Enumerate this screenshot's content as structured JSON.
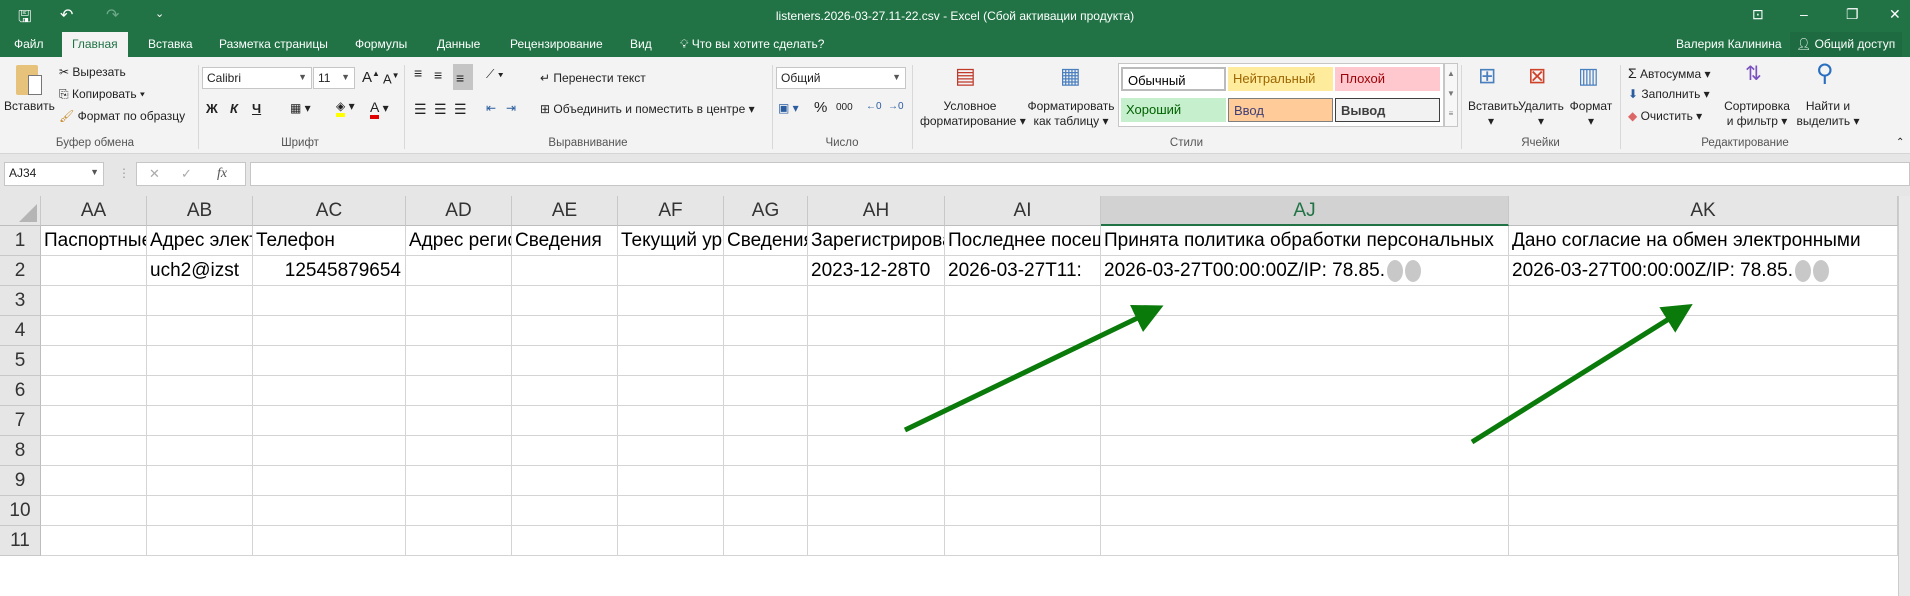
{
  "titlebar": {
    "title": "listeners.2026-03-27.11-22.csv - Excel (Сбой активации продукта)",
    "user": "Валерия Калинина",
    "share": "Общий доступ"
  },
  "tabs": [
    "Файл",
    "Главная",
    "Вставка",
    "Разметка страницы",
    "Формулы",
    "Данные",
    "Рецензирование",
    "Вид"
  ],
  "tell_me": "Что вы хотите сделать?",
  "ribbon": {
    "clipboard": {
      "paste": "Вставить",
      "cut": "Вырезать",
      "copy": "Копировать",
      "format_painter": "Формат по образцу",
      "label": "Буфер обмена"
    },
    "font": {
      "name": "Calibri",
      "size": "11",
      "bold": "Ж",
      "italic": "К",
      "underline": "Ч",
      "label": "Шрифт"
    },
    "alignment": {
      "wrap": "Перенести текст",
      "merge": "Объединить и поместить в центре",
      "label": "Выравнивание"
    },
    "number": {
      "format": "Общий",
      "percent": "%",
      "thousands": "000",
      "label": "Число"
    },
    "styles": {
      "conditional": [
        "Условное",
        "форматирование"
      ],
      "as_table": [
        "Форматировать",
        "как таблицу"
      ],
      "cells": [
        "Обычный",
        "Нейтральный",
        "Плохой",
        "Хороший",
        "Ввод",
        "Вывод"
      ],
      "label": "Стили"
    },
    "cells": {
      "insert": "Вставить",
      "delete": "Удалить",
      "format": "Формат",
      "label": "Ячейки"
    },
    "editing": {
      "autosum": "Автосумма",
      "fill": "Заполнить",
      "clear": "Очистить",
      "sort": [
        "Сортировка",
        "и фильтр"
      ],
      "find": [
        "Найти и",
        "выделить"
      ],
      "label": "Редактирование"
    }
  },
  "formula_bar": {
    "name_box": "AJ34",
    "formula": ""
  },
  "grid": {
    "selected_column": "AJ",
    "columns": [
      "AA",
      "AB",
      "AC",
      "AD",
      "AE",
      "AF",
      "AG",
      "AH",
      "AI",
      "AJ",
      "AK"
    ],
    "rows": [
      "1",
      "2",
      "3",
      "4",
      "5",
      "6",
      "7",
      "8",
      "9",
      "10",
      "11"
    ],
    "row1": [
      "Паспортные",
      "Адрес электронной",
      "Телефон",
      "Адрес регистрации",
      "Сведения",
      "Текущий уровень",
      "Сведения",
      "Зарегистрирован",
      "Последнее посещение",
      "Принята политика обработки персональных",
      "Дано согласие на обмен электронными"
    ],
    "row2": [
      "",
      "uch2@izst",
      "12545879654",
      "",
      "",
      "",
      "",
      "2023-12-28T0",
      "2026-03-27T11:",
      "2026-03-27T00:00:00Z/IP: 78.85.",
      "2026-03-27T00:00:00Z/IP: 78.85."
    ]
  },
  "annotation_color": "#0a7a0a"
}
